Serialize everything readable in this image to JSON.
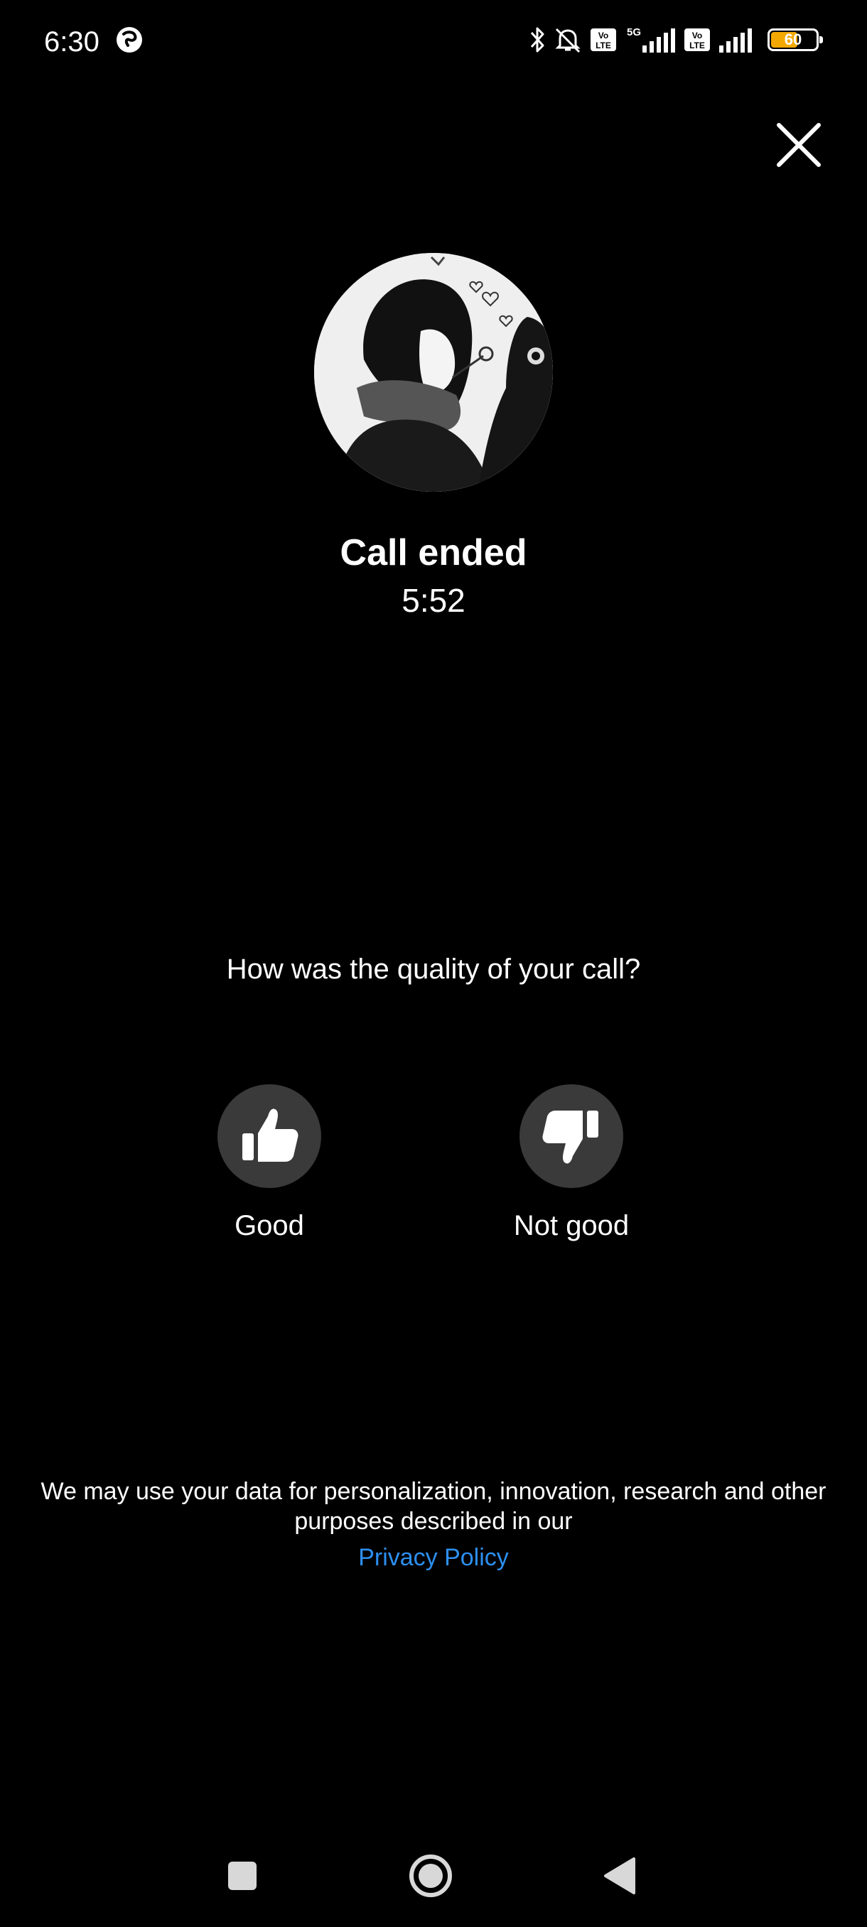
{
  "status_bar": {
    "time": "6:30",
    "battery_level": "60",
    "battery_fraction": 0.6,
    "icons": [
      "app-notification-icon",
      "bluetooth-icon",
      "bell-muted-icon",
      "volte-icon",
      "5g-signal-icon",
      "volte-icon",
      "signal-icon",
      "battery-icon"
    ]
  },
  "close_icon": "close-icon",
  "call": {
    "title": "Call ended",
    "duration": "5:52"
  },
  "rating": {
    "question": "How was the quality of your call?",
    "good_label": "Good",
    "good_icon": "thumbs-up-icon",
    "bad_label": "Not good",
    "bad_icon": "thumbs-down-icon"
  },
  "footer": {
    "disclaimer": "We may use your data for personalization, innovation, research and other purposes described in our",
    "privacy_link": "Privacy Policy"
  },
  "nav": {
    "icons": [
      "recents-square-icon",
      "home-circle-icon",
      "back-triangle-icon"
    ]
  },
  "colors": {
    "background": "#000000",
    "text": "#ffffff",
    "button_bg": "#3a3a3a",
    "link": "#2d8ff0",
    "battery_fill": "#f2a800"
  }
}
